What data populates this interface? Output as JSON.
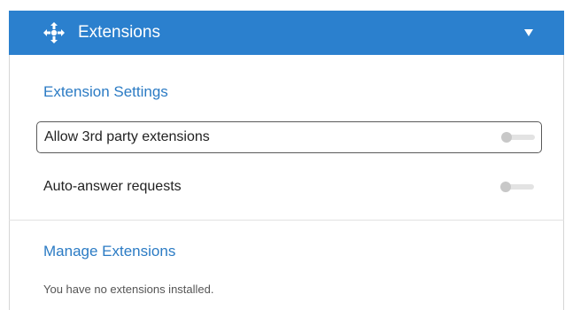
{
  "header": {
    "title": "Extensions",
    "icon": "extensions-puzzle-icon",
    "caret_icon": "chevron-down-icon",
    "background_color": "#2b80ce"
  },
  "extension_settings": {
    "title": "Extension Settings",
    "options": [
      {
        "label": "Allow 3rd party extensions",
        "enabled": false
      },
      {
        "label": "Auto-answer requests",
        "enabled": false
      }
    ]
  },
  "manage_extensions": {
    "title": "Manage Extensions",
    "empty_message": "You have no extensions installed."
  }
}
